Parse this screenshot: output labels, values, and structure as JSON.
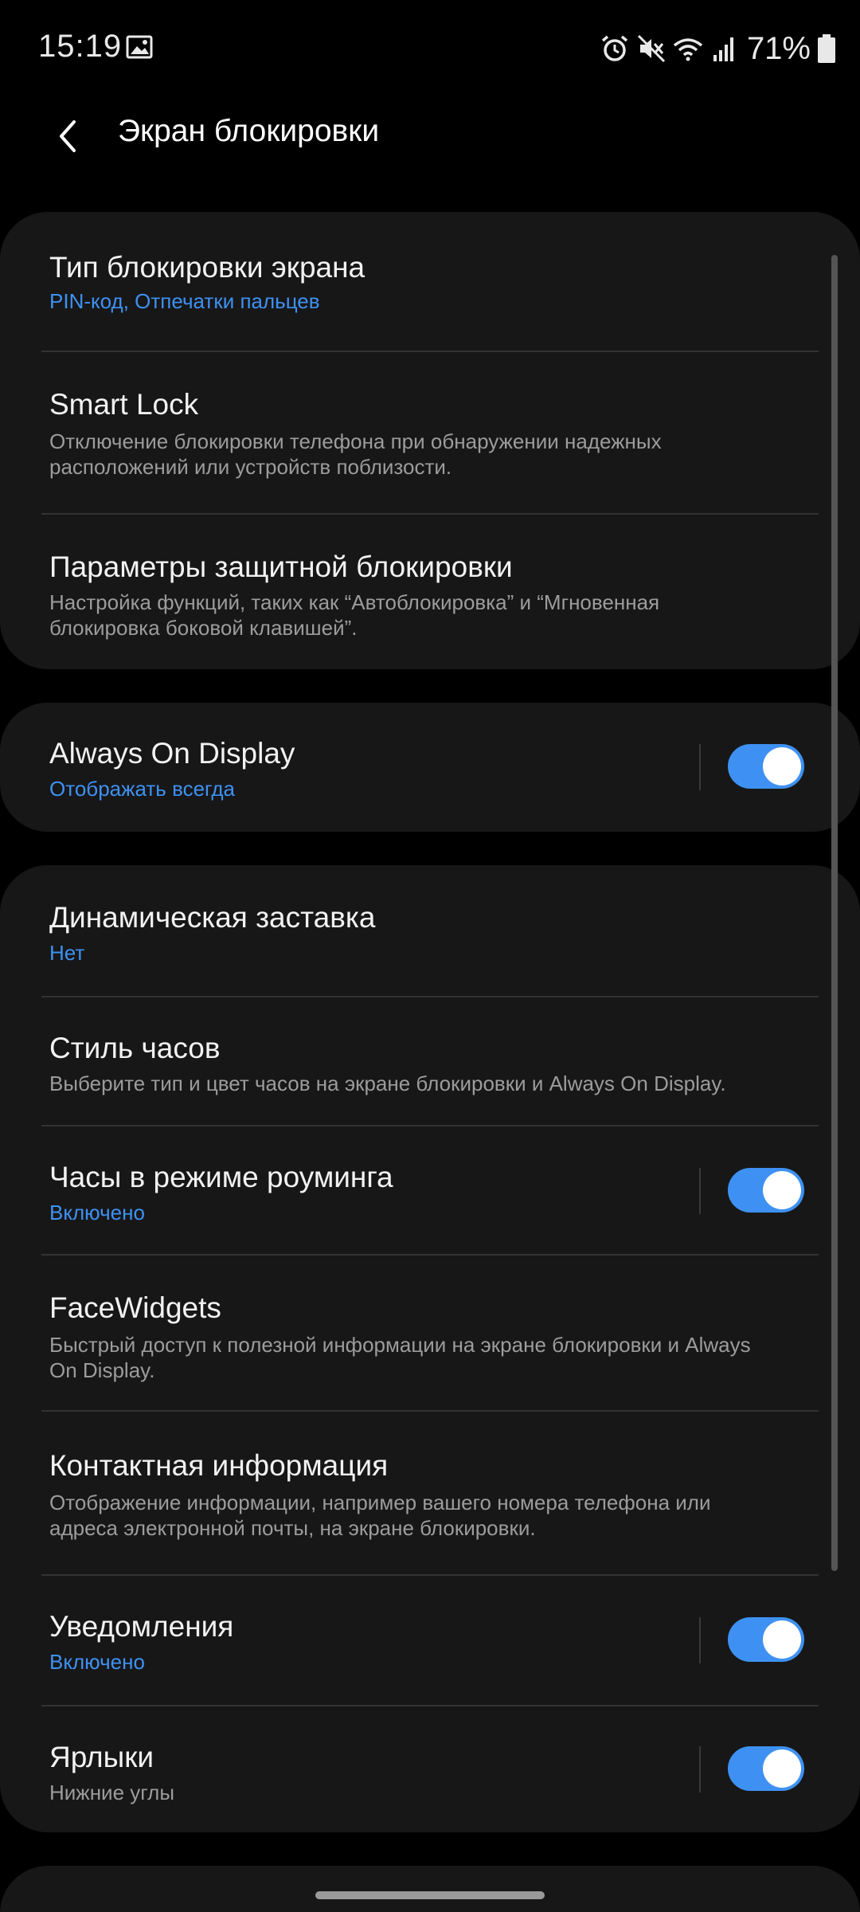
{
  "status_bar": {
    "time": "15:19",
    "battery": "71%",
    "icons": [
      "gallery-icon",
      "alarm-icon",
      "mute-icon",
      "wifi-icon",
      "signal-icon",
      "battery-icon"
    ]
  },
  "header": {
    "title": "Экран блокировки",
    "back_icon": "back-arrow-icon"
  },
  "group1": {
    "lock_type": {
      "title": "Тип блокировки экрана",
      "value": "PIN-код, Отпечатки пальцев"
    },
    "smart_lock": {
      "title": "Smart Lock",
      "description": "Отключение блокировки телефона при обнаружении надежных расположений или устройств поблизости."
    },
    "secure_lock": {
      "title": "Параметры защитной блокировки",
      "description": "Настройка функций, таких как “Автоблокировка” и “Мгновенная блокировка боковой клавишей”."
    }
  },
  "group2": {
    "aod": {
      "title": "Always On Display",
      "value": "Отображать всегда",
      "enabled": true
    }
  },
  "group3": {
    "wallpaper": {
      "title": "Динамическая заставка",
      "value": "Нет"
    },
    "clock_style": {
      "title": "Стиль часов",
      "description": "Выберите тип и цвет часов на экране блокировки и Always On Display."
    },
    "roaming_clock": {
      "title": "Часы в режиме роуминга",
      "value": "Включено",
      "enabled": true
    },
    "facewidgets": {
      "title": "FaceWidgets",
      "description": "Быстрый доступ к полезной информации на экране блокировки и Always On Display."
    },
    "contact_info": {
      "title": "Контактная информация",
      "description": "Отображение информации, например вашего номера телефона или адреса электронной почты, на экране блокировки."
    },
    "notifications": {
      "title": "Уведомления",
      "value": "Включено",
      "enabled": true
    },
    "shortcuts": {
      "title": "Ярлыки",
      "value": "Нижние углы",
      "enabled": true
    }
  },
  "colors": {
    "accent": "#3e91f2",
    "card": "#171717",
    "background": "#000000"
  }
}
